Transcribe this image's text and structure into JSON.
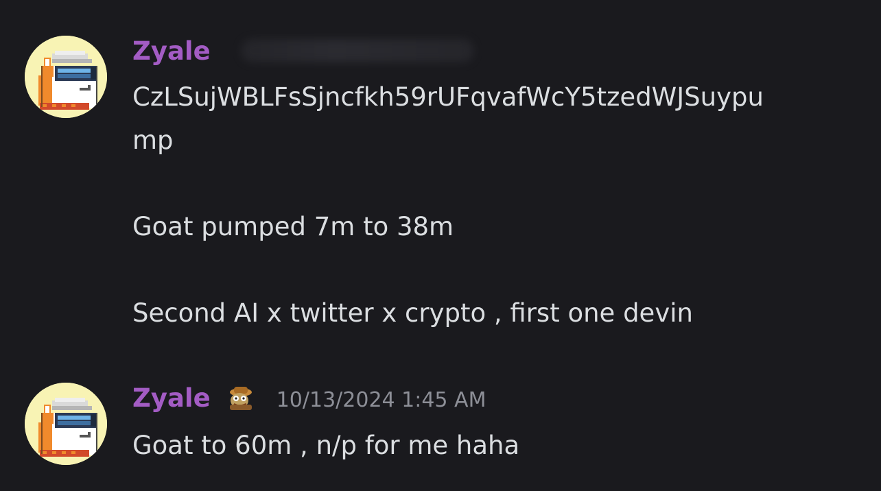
{
  "messages": [
    {
      "author": "Zyale",
      "timestamp": "",
      "lines": [
        "CzLSujWBLFsSjncfkh59rUFqvafWcY5tzedWJSuypu",
        "mp",
        "",
        "Goat pumped 7m to 38m",
        "",
        "Second AI x twitter x crypto , first one devin"
      ]
    },
    {
      "author": "Zyale",
      "timestamp": "10/13/2024 1:45 AM",
      "role_icon": "pepe-emoji-icon",
      "lines": [
        "Goat to 60m , n/p for me haha"
      ]
    }
  ],
  "colors": {
    "background": "#1a1a1e",
    "username": "#a35cc4",
    "message_text": "#dbdee1",
    "timestamp": "#8d8f97",
    "avatar_bg": "#f8f3b4"
  },
  "icons": {
    "avatar": "pixel-shiba-sunglasses-avatar",
    "role_badge": "pepe-emoji-icon"
  }
}
